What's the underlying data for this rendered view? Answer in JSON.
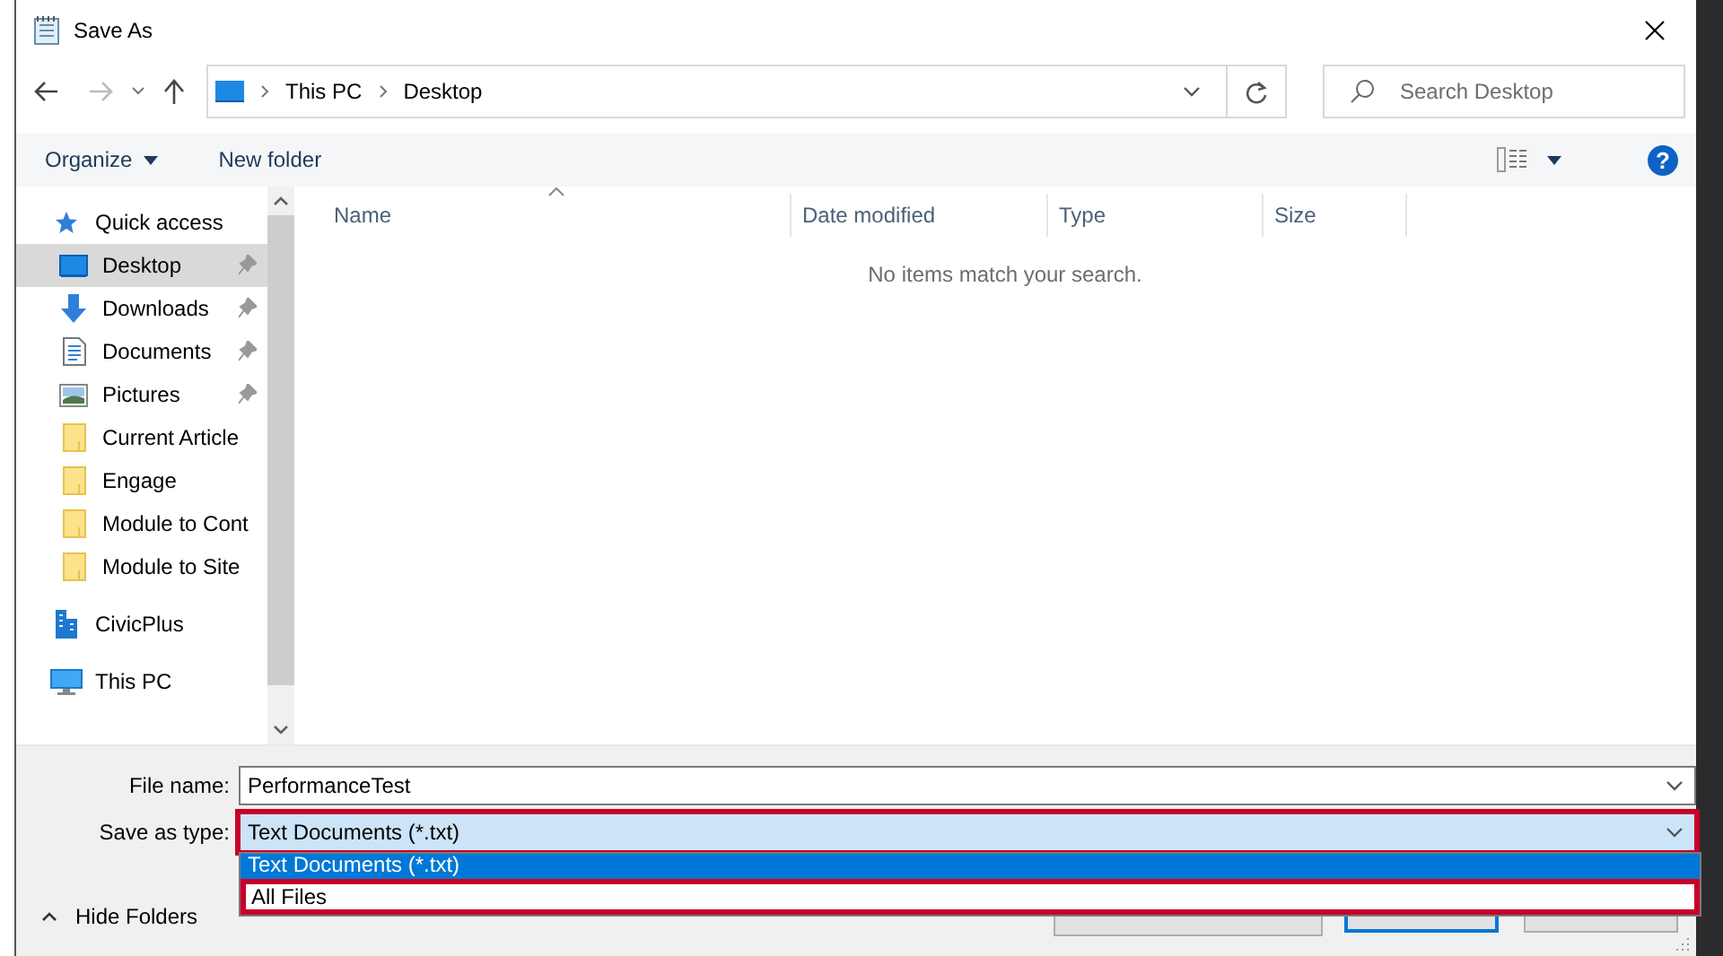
{
  "window": {
    "title": "Save As"
  },
  "address": {
    "path": [
      "This PC",
      "Desktop"
    ]
  },
  "search": {
    "placeholder": "Search Desktop"
  },
  "toolbar": {
    "organize": "Organize",
    "new_folder": "New folder",
    "help": "?"
  },
  "nav": {
    "items": [
      {
        "label": "Quick access",
        "kind": "star",
        "selected": false,
        "children": [
          {
            "label": "Desktop",
            "kind": "desktop",
            "pinned": true,
            "selected": true
          },
          {
            "label": "Downloads",
            "kind": "download",
            "pinned": true,
            "selected": false
          },
          {
            "label": "Documents",
            "kind": "document",
            "pinned": true,
            "selected": false
          },
          {
            "label": "Pictures",
            "kind": "pictures",
            "pinned": true,
            "selected": false
          },
          {
            "label": "Current Article",
            "kind": "folder",
            "pinned": false,
            "selected": false
          },
          {
            "label": "Engage",
            "kind": "folder",
            "pinned": false,
            "selected": false
          },
          {
            "label": "Module to Cont",
            "kind": "folder",
            "pinned": false,
            "selected": false
          },
          {
            "label": "Module to Site",
            "kind": "folder",
            "pinned": false,
            "selected": false
          }
        ]
      },
      {
        "label": "CivicPlus",
        "kind": "building",
        "selected": false
      },
      {
        "label": "This PC",
        "kind": "pc",
        "selected": false
      }
    ]
  },
  "file_list": {
    "columns": [
      "Name",
      "Date modified",
      "Type",
      "Size"
    ],
    "empty_message": "No items match your search."
  },
  "file_name": {
    "label": "File name:",
    "value": "PerformanceTest"
  },
  "save_as_type": {
    "label": "Save as type:",
    "value": "Text Documents (*.txt)",
    "highlighted": true,
    "options": [
      {
        "label": "Text Documents (*.txt)",
        "selected": true,
        "highlighted": false
      },
      {
        "label": "All Files",
        "selected": false,
        "highlighted": true
      }
    ]
  },
  "buttons": [
    {
      "default": true
    },
    {
      "default": false
    }
  ],
  "hide_folders": "Hide Folders"
}
